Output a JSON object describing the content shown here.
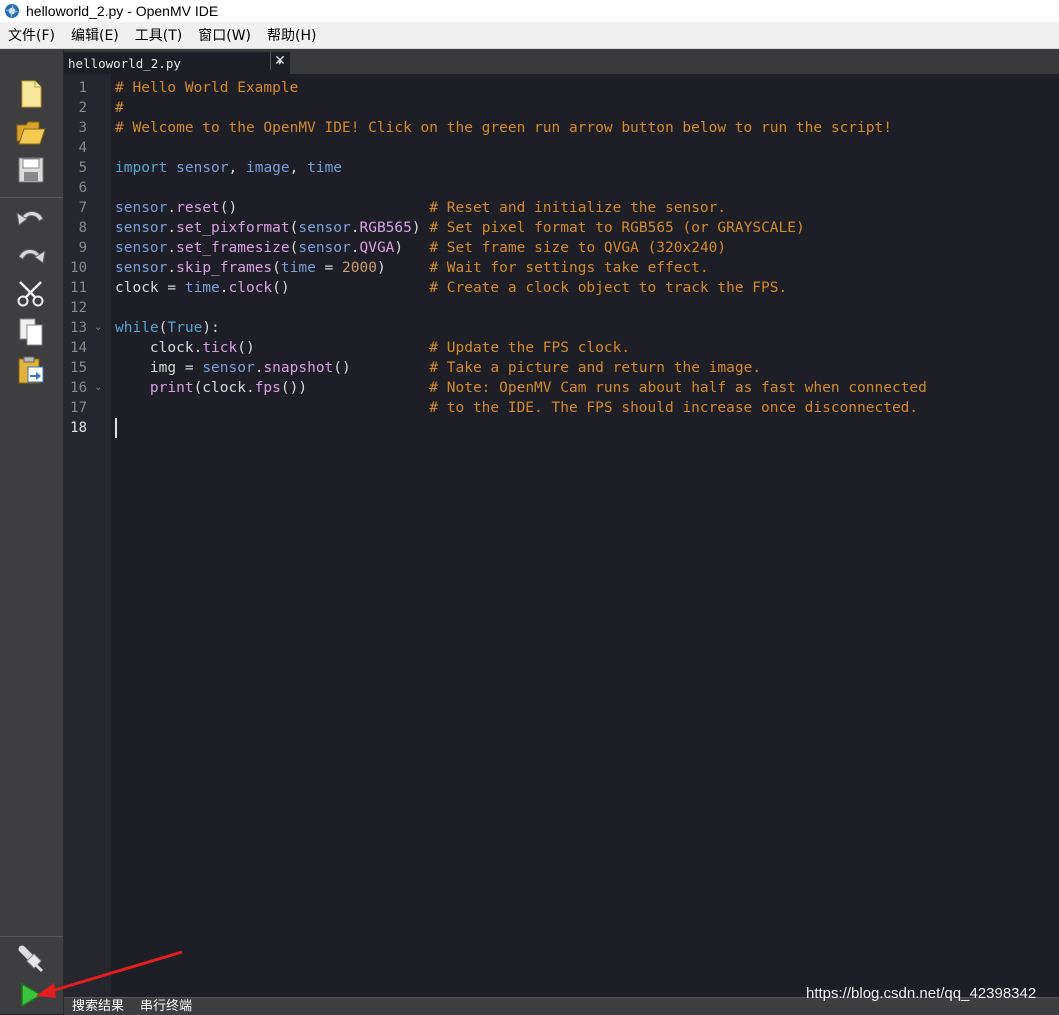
{
  "window": {
    "title": "helloworld_2.py - OpenMV IDE"
  },
  "menu": {
    "items": [
      "文件(F)",
      "编辑(E)",
      "工具(T)",
      "窗口(W)",
      "帮助(H)"
    ]
  },
  "toolbar": {
    "icons": [
      "new-file-icon",
      "open-folder-icon",
      "save-icon",
      "undo-icon",
      "redo-icon",
      "cut-icon",
      "copy-icon",
      "paste-icon",
      "connect-icon",
      "run-icon"
    ]
  },
  "tab": {
    "filename": "helloworld_2.py",
    "dropdown": "▾",
    "close": "✕"
  },
  "editor": {
    "current_line": 18,
    "line_numbers": [
      "1",
      "2",
      "3",
      "4",
      "5",
      "6",
      "7",
      "8",
      "9",
      "10",
      "11",
      "12",
      "13",
      "14",
      "15",
      "16",
      "17",
      "18"
    ],
    "lines": [
      "# Hello World Example",
      "#",
      "# Welcome to the OpenMV IDE! Click on the green run arrow button below to run the script!",
      "",
      "import sensor, image, time",
      "",
      "sensor.reset()                      # Reset and initialize the sensor.",
      "sensor.set_pixformat(sensor.RGB565) # Set pixel format to RGB565 (or GRAYSCALE)",
      "sensor.set_framesize(sensor.QVGA)   # Set frame size to QVGA (320x240)",
      "sensor.skip_frames(time = 2000)     # Wait for settings take effect.",
      "clock = time.clock()                # Create a clock object to track the FPS.",
      "",
      "while(True):",
      "    clock.tick()                    # Update the FPS clock.",
      "    img = sensor.snapshot()         # Take a picture and return the image.",
      "    print(clock.fps())              # Note: OpenMV Cam runs about half as fast when connected",
      "                                    # to the IDE. The FPS should increase once disconnected.",
      ""
    ]
  },
  "bottom": {
    "tabs": [
      "搜索结果",
      "串行终端"
    ]
  },
  "watermark": "https://blog.csdn.net/qq_42398342",
  "colors": {
    "editor_bg": "#1e1f26",
    "comment": "#d08a2e",
    "keyword": "#5da2c9",
    "toolbar_bg": "#3e3e40",
    "annotation": "#e02020"
  }
}
